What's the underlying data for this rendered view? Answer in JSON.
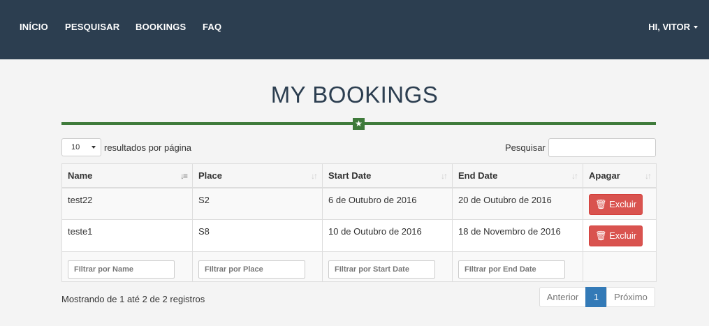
{
  "nav": {
    "links": [
      "INÍCIO",
      "PESQUISAR",
      "BOOKINGS",
      "FAQ"
    ],
    "user": "HI, VITOR"
  },
  "page": {
    "title": "MY BOOKINGS"
  },
  "controls": {
    "length_value": "10",
    "length_label": "resultados por página",
    "search_label": "Pesquisar",
    "search_value": ""
  },
  "table": {
    "headers": [
      "Name",
      "Place",
      "Start Date",
      "End Date",
      "Apagar"
    ],
    "rows": [
      {
        "name": "test22",
        "place": "S2",
        "start": "6 de Outubro de 2016",
        "end": "20 de Outubro de 2016",
        "action": "Excluir"
      },
      {
        "name": "teste1",
        "place": "S8",
        "start": "10 de Outubro de 2016",
        "end": "18 de Novembro de 2016",
        "action": "Excluir"
      }
    ],
    "filters": [
      "FIltrar por Name",
      "FIltrar por Place",
      "FIltrar por Start Date",
      "FIltrar por End Date"
    ]
  },
  "footer": {
    "info": "Mostrando de 1 até 2 de 2 registros",
    "prev": "Anterior",
    "current": "1",
    "next": "Próximo"
  }
}
